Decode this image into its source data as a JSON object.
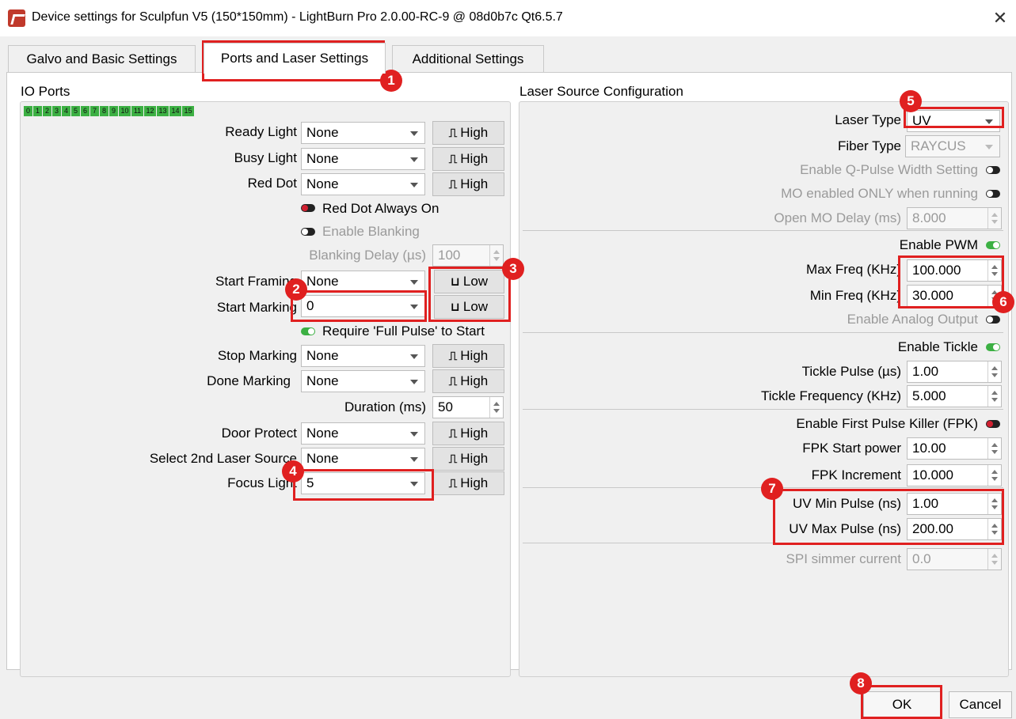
{
  "window": {
    "title": "Device settings for Sculpfun V5  (150*150mm)   - LightBurn Pro 2.0.00-RC-9 @ 08d0b7c Qt6.5.7",
    "close_glyph": "✕"
  },
  "tabs": [
    "Galvo and Basic Settings",
    "Ports and Laser Settings",
    "Additional Settings"
  ],
  "active_tab": "Ports and Laser Settings",
  "io_ports": {
    "title": "IO Ports",
    "indicators": [
      "0",
      "1",
      "2",
      "3",
      "4",
      "5",
      "6",
      "7",
      "8",
      "9",
      "10",
      "11",
      "12",
      "13",
      "14",
      "15"
    ],
    "rows": [
      {
        "label": "Ready Light",
        "value": "None",
        "polarity": "High"
      },
      {
        "label": "Busy Light",
        "value": "None",
        "polarity": "High"
      },
      {
        "label": "Red Dot",
        "value": "None",
        "polarity": "High"
      },
      {
        "label": "Start Framing",
        "value": "None",
        "polarity": "Low"
      },
      {
        "label": "Start Marking",
        "value": "0",
        "polarity": "Low"
      },
      {
        "label": "Stop Marking",
        "value": "None",
        "polarity": "High"
      },
      {
        "label": "Done Marking",
        "value": "None",
        "polarity": "High"
      },
      {
        "label": "Door Protect",
        "value": "None",
        "polarity": "High"
      },
      {
        "label": "Select 2nd Laser Source",
        "value": "None",
        "polarity": "High"
      },
      {
        "label": "Focus Light",
        "value": "5",
        "polarity": "High"
      }
    ],
    "red_dot_always_on": "Red Dot Always On",
    "enable_blanking": "Enable Blanking",
    "blanking_delay_label": "Blanking Delay (µs)",
    "blanking_delay_value": "100",
    "require_full_pulse": "Require 'Full Pulse' to Start",
    "duration_label": "Duration (ms)",
    "duration_value": "50"
  },
  "laser_source": {
    "title": "Laser Source Configuration",
    "laser_type_label": "Laser Type",
    "laser_type_value": "UV",
    "fiber_type_label": "Fiber Type",
    "fiber_type_value": "RAYCUS",
    "enable_q_pulse": "Enable Q-Pulse Width Setting",
    "mo_enabled": "MO enabled ONLY when running",
    "open_mo_delay_label": "Open MO Delay (ms)",
    "open_mo_delay_value": "8.000",
    "enable_pwm": "Enable PWM",
    "max_freq_label": "Max Freq (KHz)",
    "max_freq_value": "100.000",
    "min_freq_label": "Min Freq (KHz)",
    "min_freq_value": "30.000",
    "enable_analog": "Enable Analog Output",
    "enable_tickle": "Enable Tickle",
    "tickle_pulse_label": "Tickle Pulse (µs)",
    "tickle_pulse_value": "1.00",
    "tickle_freq_label": "Tickle Frequency (KHz)",
    "tickle_freq_value": "5.000",
    "enable_fpk": "Enable First Pulse Killer (FPK)",
    "fpk_start_label": "FPK Start power",
    "fpk_start_value": "10.00",
    "fpk_increment_label": "FPK Increment",
    "fpk_increment_value": "10.000",
    "uv_min_label": "UV Min Pulse (ns)",
    "uv_min_value": "1.00",
    "uv_max_label": "UV Max Pulse (ns)",
    "uv_max_value": "200.00",
    "spi_label": "SPI simmer current",
    "spi_value": "0.0"
  },
  "buttons": {
    "ok": "OK",
    "cancel": "Cancel"
  },
  "badges": [
    "1",
    "2",
    "3",
    "4",
    "5",
    "6",
    "7",
    "8"
  ],
  "colors": {
    "annotation_red": "#e02020",
    "toggle_green": "#3cb043",
    "io_green": "#3cb043"
  }
}
